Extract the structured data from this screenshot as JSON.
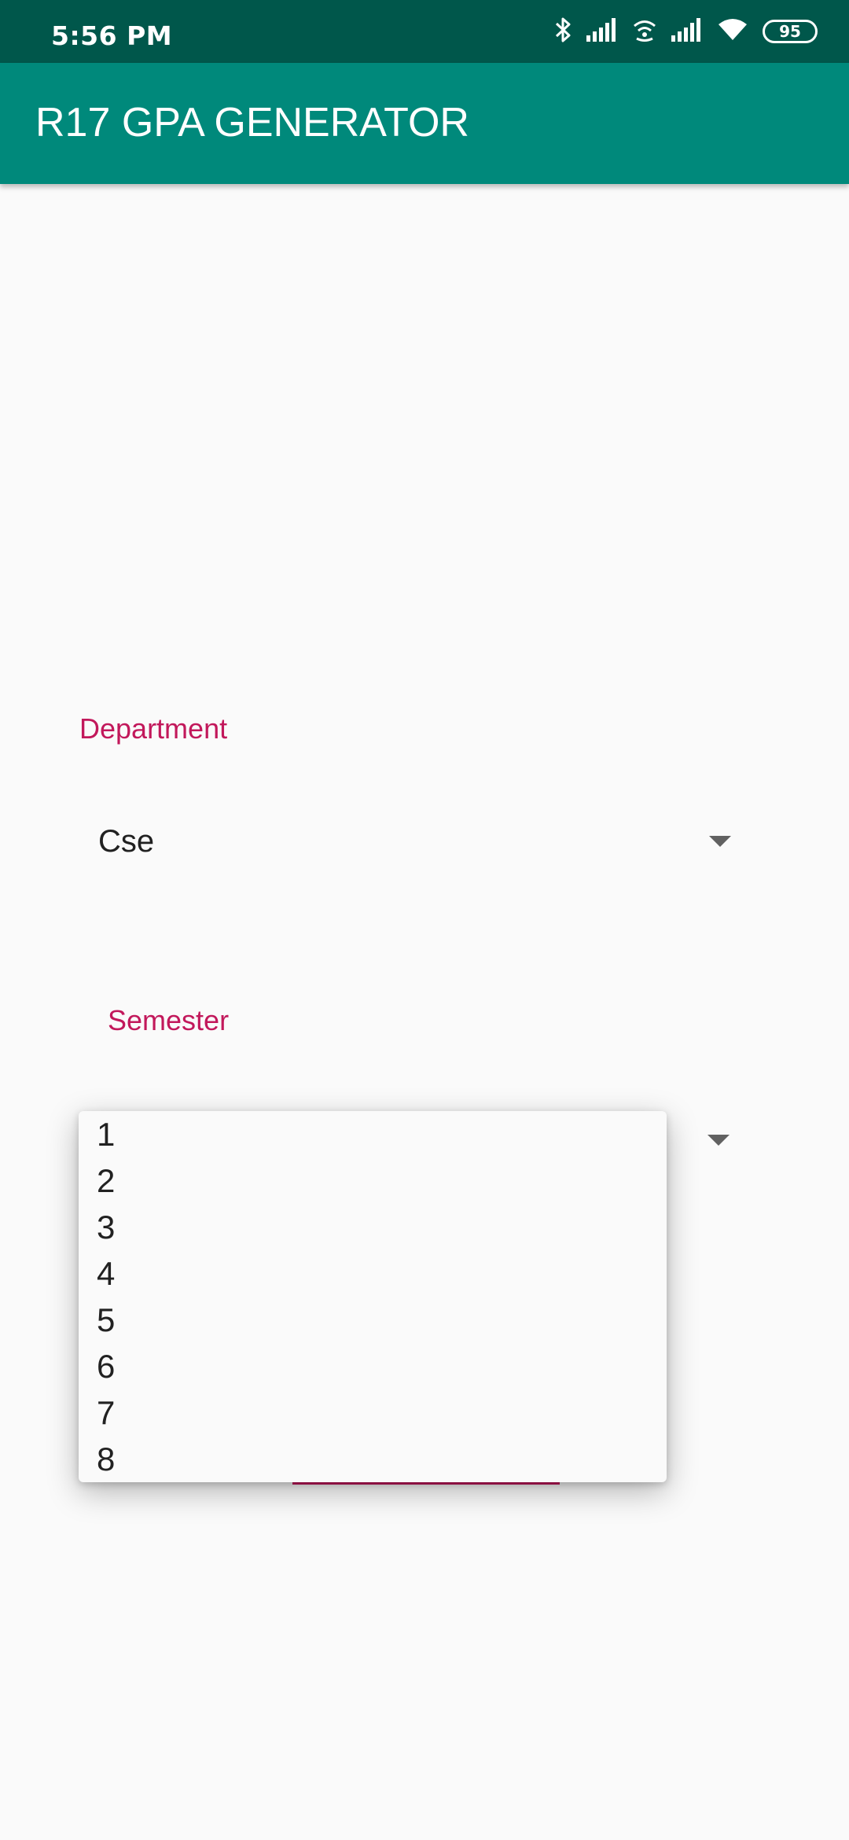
{
  "status_bar": {
    "time": "5:56 PM",
    "battery": "95",
    "icons": [
      "bluetooth-icon",
      "signal-icon",
      "wifi-calling-icon",
      "signal-icon",
      "wifi-icon",
      "battery-icon"
    ]
  },
  "app_bar": {
    "title": "R17 GPA GENERATOR"
  },
  "department": {
    "label": "Department",
    "selected": "Cse"
  },
  "semester": {
    "label": "Semester",
    "options": [
      "1",
      "2",
      "3",
      "4",
      "5",
      "6",
      "7",
      "8"
    ]
  },
  "colors": {
    "status_bar": "#00574b",
    "app_bar": "#00897b",
    "accent": "#c2185b",
    "background": "#fafafa"
  }
}
